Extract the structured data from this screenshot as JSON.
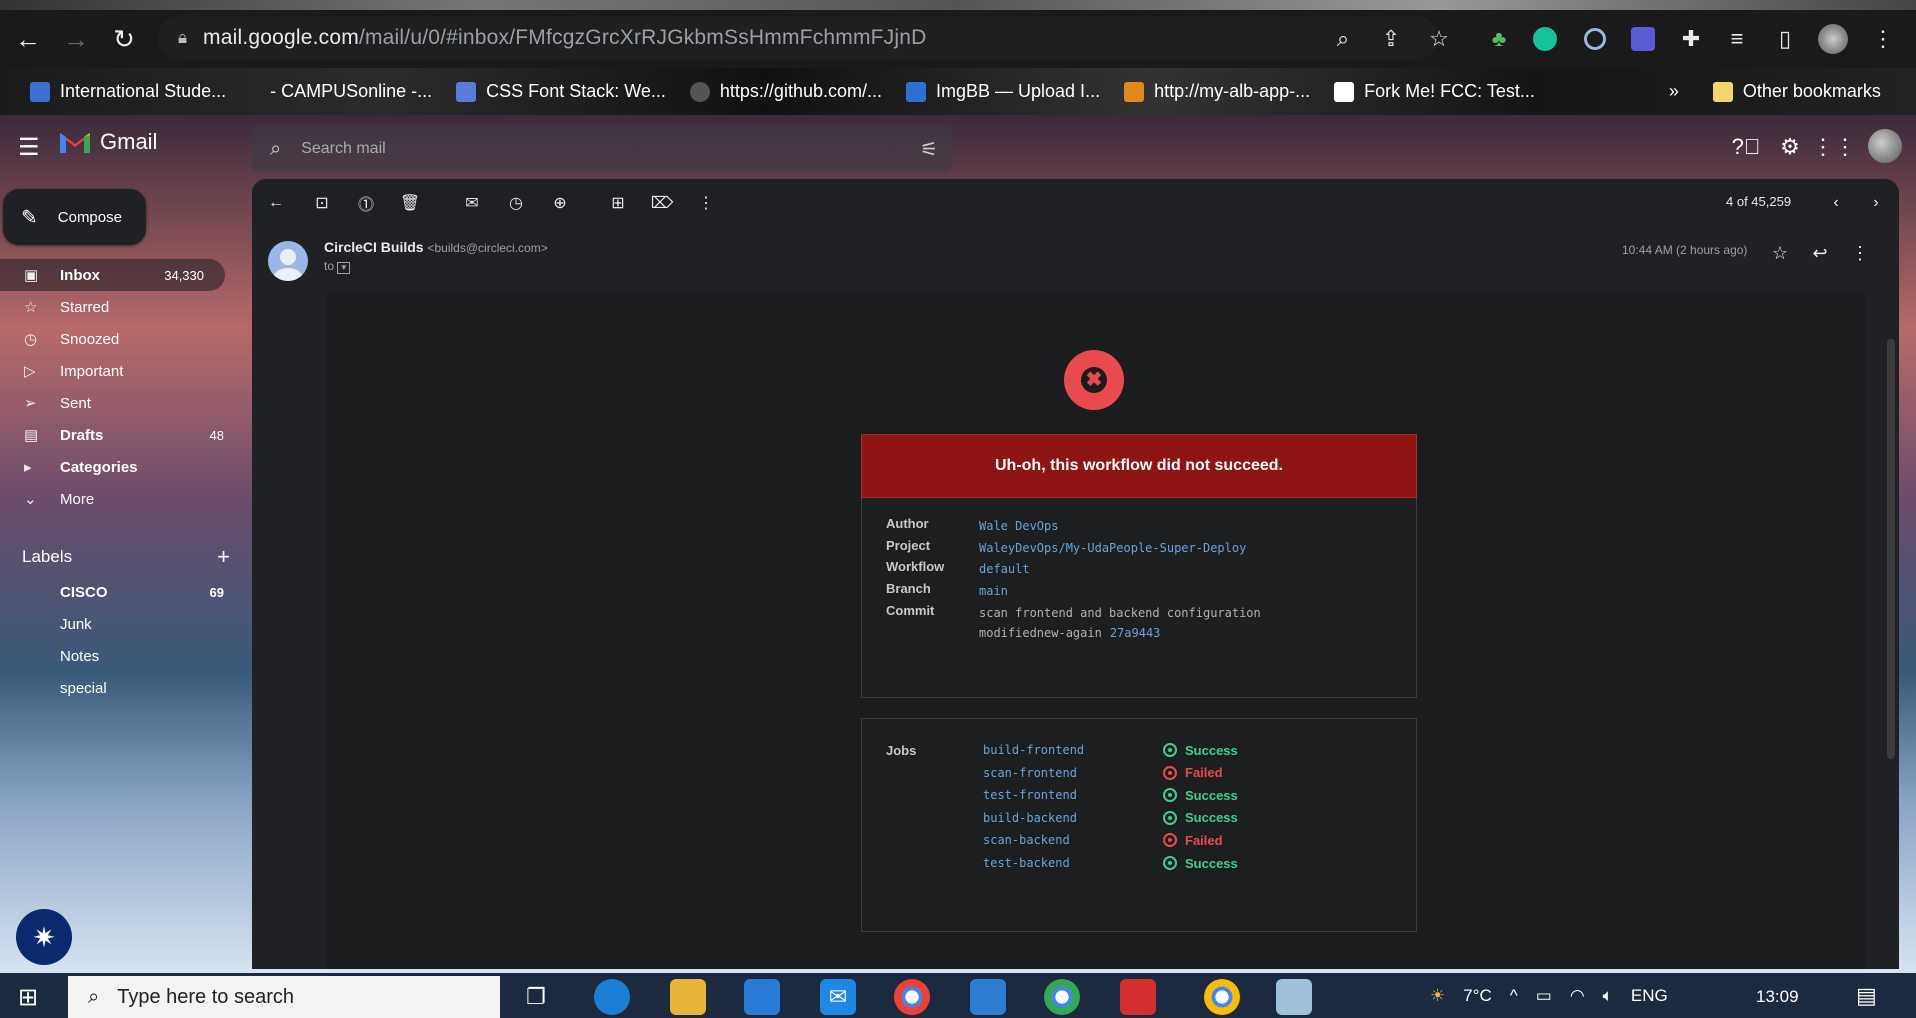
{
  "browser": {
    "url_host": "mail.google.com",
    "url_path": "/mail/u/0/#inbox/FMfcgzGrcXrRJGkbmSsHmmFchmmFJjnD",
    "bookmarks": [
      {
        "label": "International Stude...",
        "color": "#3b6fd4"
      },
      {
        "label": "- CAMPUSonline -...",
        "color": "#2a2a2a"
      },
      {
        "label": "CSS Font Stack: We...",
        "color": "#5a7bd8"
      },
      {
        "label": "https://github.com/...",
        "color": "#555555"
      },
      {
        "label": "ImgBB — Upload I...",
        "color": "#2e6fd6"
      },
      {
        "label": "http://my-alb-app-...",
        "color": "#e08a1e"
      },
      {
        "label": "Fork Me! FCC: Test...",
        "color": "#ffffff"
      }
    ],
    "more_bookmarks": "»",
    "other_bookmarks": "Other bookmarks"
  },
  "gmail": {
    "logo_text": "Gmail",
    "search_placeholder": "Search mail",
    "compose_label": "Compose",
    "nav": [
      {
        "label": "Inbox",
        "count": "34,330",
        "icon": "inbox-icon",
        "glyph": "▣",
        "bold": true
      },
      {
        "label": "Starred",
        "count": "",
        "icon": "star-icon",
        "glyph": "☆",
        "bold": false
      },
      {
        "label": "Snoozed",
        "count": "",
        "icon": "clock-icon",
        "glyph": "◷",
        "bold": false
      },
      {
        "label": "Important",
        "count": "",
        "icon": "important-icon",
        "glyph": "▷",
        "bold": false
      },
      {
        "label": "Sent",
        "count": "",
        "icon": "send-icon",
        "glyph": "➢",
        "bold": false
      },
      {
        "label": "Drafts",
        "count": "48",
        "icon": "draft-icon",
        "glyph": "▤",
        "bold": true
      },
      {
        "label": "Categories",
        "count": "",
        "icon": "expand-icon",
        "glyph": "▸",
        "bold": true
      },
      {
        "label": "More",
        "count": "",
        "icon": "chevron-down-icon",
        "glyph": "⌄",
        "bold": false
      }
    ],
    "labels_heading": "Labels",
    "labels": [
      {
        "label": "CISCO",
        "count": "69",
        "bold": true
      },
      {
        "label": "Junk",
        "count": "",
        "bold": false
      },
      {
        "label": "Notes",
        "count": "",
        "bold": false
      },
      {
        "label": "special",
        "count": "",
        "bold": false
      }
    ],
    "pager": "4 of 45,259",
    "message": {
      "sender_name": "CircleCI Builds",
      "sender_email": "<builds@circleci.com>",
      "to": "to",
      "date": "10:44 AM (2 hours ago)"
    }
  },
  "email_body": {
    "banner": "Uh-oh, this workflow did not succeed.",
    "details": [
      {
        "key": "Author",
        "value": "Wale DevOps",
        "style": "link"
      },
      {
        "key": "Project",
        "value": "WaleyDevOps/My-UdaPeople-Super-Deploy",
        "style": "link"
      },
      {
        "key": "Workflow",
        "value": "default",
        "style": "link"
      },
      {
        "key": "Branch",
        "value": "main",
        "style": "link"
      }
    ],
    "commit": {
      "key": "Commit",
      "line1": "scan frontend and backend configuration",
      "line2": "modifiednew-again",
      "hash": "27a9443"
    },
    "jobs_label": "Jobs",
    "jobs": [
      {
        "name": "build-frontend",
        "status": "Success",
        "ok": true
      },
      {
        "name": "scan-frontend",
        "status": "Failed",
        "ok": false
      },
      {
        "name": "test-frontend",
        "status": "Success",
        "ok": true
      },
      {
        "name": "build-backend",
        "status": "Success",
        "ok": true
      },
      {
        "name": "scan-backend",
        "status": "Failed",
        "ok": false
      },
      {
        "name": "test-backend",
        "status": "Success",
        "ok": true
      }
    ]
  },
  "taskbar": {
    "search_placeholder": "Type here to search",
    "temperature": "7°C",
    "language": "ENG",
    "time": "13:09"
  },
  "colors": {
    "success": "#3ecf8e",
    "failed": "#e84a4f",
    "banner": "#8f1414",
    "link": "#6aa3d8"
  }
}
